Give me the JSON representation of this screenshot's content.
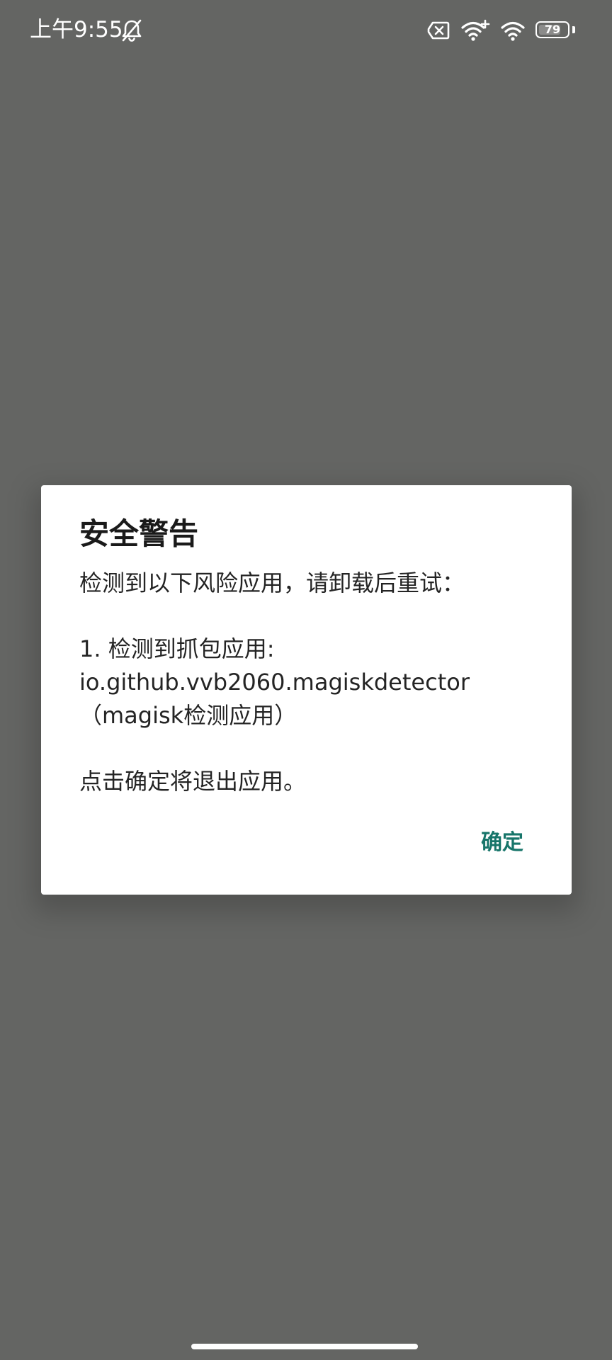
{
  "status_bar": {
    "time": "上午9:55",
    "battery_level": "79",
    "battery_percent": 79,
    "icons": [
      "bell-off-icon",
      "sim-error-icon",
      "wifi-plus-icon",
      "wifi-icon",
      "battery-icon"
    ]
  },
  "dialog": {
    "title": "安全警告",
    "message_lines": [
      "检测到以下风险应用，请卸载后重试：",
      "",
      "1. 检测到抓包应用:",
      "io.github.vvb2060.magiskdetector",
      "（magisk检测应用）",
      "",
      "点击确定将退出应用。"
    ],
    "confirm_label": "确定"
  },
  "colors": {
    "scrim": "#646563",
    "dialog_bg": "#ffffff",
    "accent": "#17756a",
    "text": "#242424"
  }
}
